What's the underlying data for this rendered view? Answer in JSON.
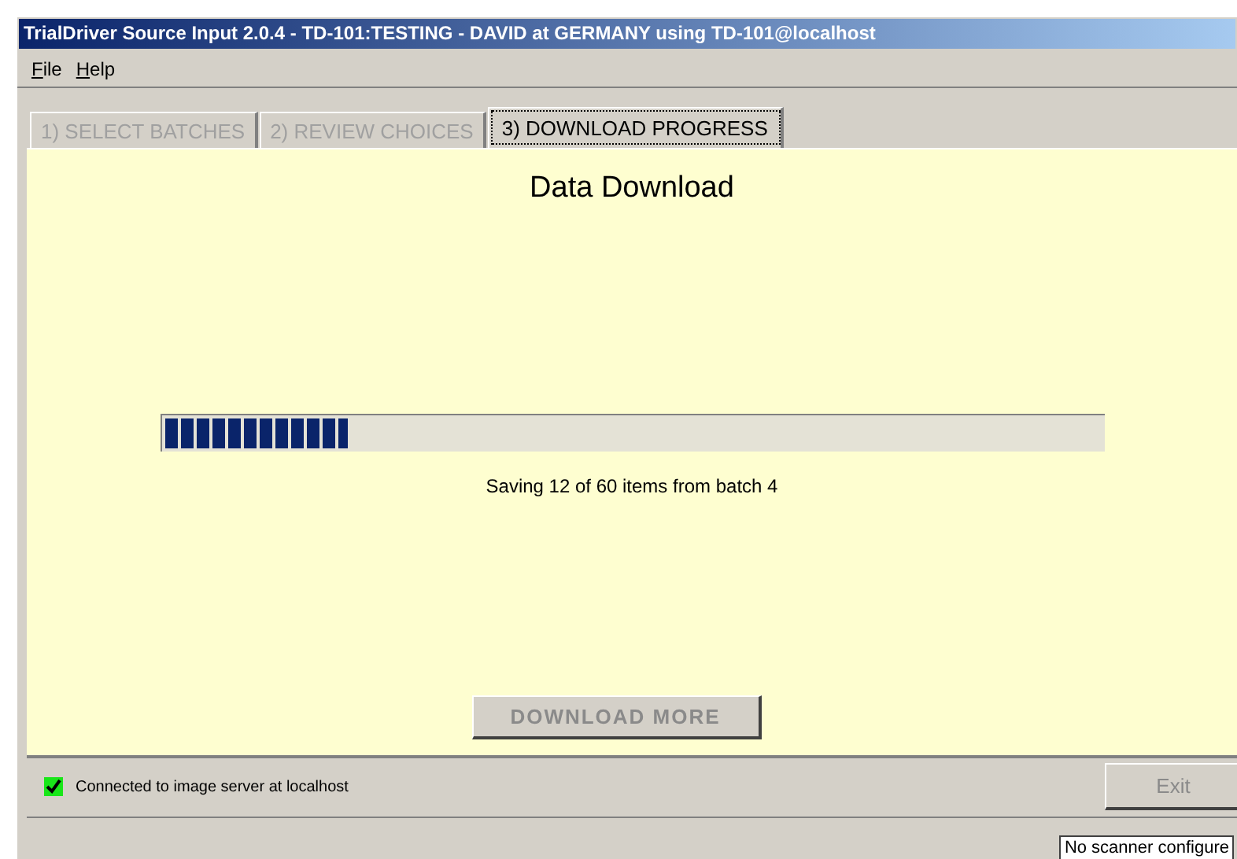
{
  "window": {
    "title": "TrialDriver Source Input 2.0.4 - TD-101:TESTING - DAVID at GERMANY using TD-101@localhost"
  },
  "menu": [
    {
      "label": "File"
    },
    {
      "label": "Help"
    }
  ],
  "tabs": [
    {
      "label": "1) SELECT BATCHES",
      "selected": false
    },
    {
      "label": "2) REVIEW CHOICES",
      "selected": false
    },
    {
      "label": "3) DOWNLOAD PROGRESS",
      "selected": true
    }
  ],
  "panel": {
    "heading": "Data Download",
    "progress": {
      "level": 0.195
    },
    "message": "Saving 12 of 60 items from batch 4",
    "button": {
      "label": "DOWNLOAD MORE",
      "disabled": true
    }
  },
  "connection": {
    "checked": true,
    "label": "Connected to image server at localhost"
  },
  "exit_button": {
    "label": "Exit",
    "disabled": true
  },
  "status_bar": {
    "text": "No scanner configure"
  }
}
